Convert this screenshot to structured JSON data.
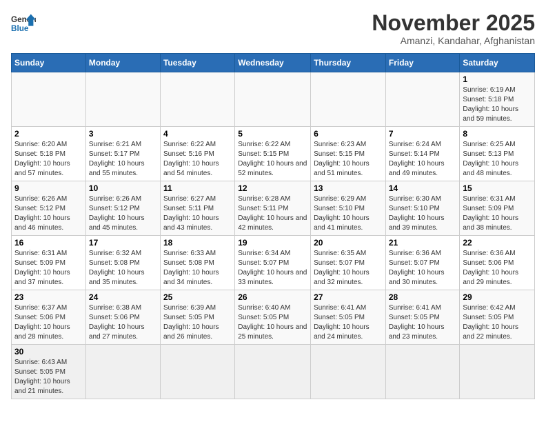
{
  "logo": {
    "text_general": "General",
    "text_blue": "Blue"
  },
  "header": {
    "title": "November 2025",
    "subtitle": "Amanzi, Kandahar, Afghanistan"
  },
  "weekdays": [
    "Sunday",
    "Monday",
    "Tuesday",
    "Wednesday",
    "Thursday",
    "Friday",
    "Saturday"
  ],
  "days": [
    {
      "num": "",
      "info": ""
    },
    {
      "num": "",
      "info": ""
    },
    {
      "num": "",
      "info": ""
    },
    {
      "num": "",
      "info": ""
    },
    {
      "num": "",
      "info": ""
    },
    {
      "num": "",
      "info": ""
    },
    {
      "num": "1",
      "info": "Sunrise: 6:19 AM\nSunset: 5:18 PM\nDaylight: 10 hours and 59 minutes."
    },
    {
      "num": "2",
      "info": "Sunrise: 6:20 AM\nSunset: 5:18 PM\nDaylight: 10 hours and 57 minutes."
    },
    {
      "num": "3",
      "info": "Sunrise: 6:21 AM\nSunset: 5:17 PM\nDaylight: 10 hours and 55 minutes."
    },
    {
      "num": "4",
      "info": "Sunrise: 6:22 AM\nSunset: 5:16 PM\nDaylight: 10 hours and 54 minutes."
    },
    {
      "num": "5",
      "info": "Sunrise: 6:22 AM\nSunset: 5:15 PM\nDaylight: 10 hours and 52 minutes."
    },
    {
      "num": "6",
      "info": "Sunrise: 6:23 AM\nSunset: 5:15 PM\nDaylight: 10 hours and 51 minutes."
    },
    {
      "num": "7",
      "info": "Sunrise: 6:24 AM\nSunset: 5:14 PM\nDaylight: 10 hours and 49 minutes."
    },
    {
      "num": "8",
      "info": "Sunrise: 6:25 AM\nSunset: 5:13 PM\nDaylight: 10 hours and 48 minutes."
    },
    {
      "num": "9",
      "info": "Sunrise: 6:26 AM\nSunset: 5:12 PM\nDaylight: 10 hours and 46 minutes."
    },
    {
      "num": "10",
      "info": "Sunrise: 6:26 AM\nSunset: 5:12 PM\nDaylight: 10 hours and 45 minutes."
    },
    {
      "num": "11",
      "info": "Sunrise: 6:27 AM\nSunset: 5:11 PM\nDaylight: 10 hours and 43 minutes."
    },
    {
      "num": "12",
      "info": "Sunrise: 6:28 AM\nSunset: 5:11 PM\nDaylight: 10 hours and 42 minutes."
    },
    {
      "num": "13",
      "info": "Sunrise: 6:29 AM\nSunset: 5:10 PM\nDaylight: 10 hours and 41 minutes."
    },
    {
      "num": "14",
      "info": "Sunrise: 6:30 AM\nSunset: 5:10 PM\nDaylight: 10 hours and 39 minutes."
    },
    {
      "num": "15",
      "info": "Sunrise: 6:31 AM\nSunset: 5:09 PM\nDaylight: 10 hours and 38 minutes."
    },
    {
      "num": "16",
      "info": "Sunrise: 6:31 AM\nSunset: 5:09 PM\nDaylight: 10 hours and 37 minutes."
    },
    {
      "num": "17",
      "info": "Sunrise: 6:32 AM\nSunset: 5:08 PM\nDaylight: 10 hours and 35 minutes."
    },
    {
      "num": "18",
      "info": "Sunrise: 6:33 AM\nSunset: 5:08 PM\nDaylight: 10 hours and 34 minutes."
    },
    {
      "num": "19",
      "info": "Sunrise: 6:34 AM\nSunset: 5:07 PM\nDaylight: 10 hours and 33 minutes."
    },
    {
      "num": "20",
      "info": "Sunrise: 6:35 AM\nSunset: 5:07 PM\nDaylight: 10 hours and 32 minutes."
    },
    {
      "num": "21",
      "info": "Sunrise: 6:36 AM\nSunset: 5:07 PM\nDaylight: 10 hours and 30 minutes."
    },
    {
      "num": "22",
      "info": "Sunrise: 6:36 AM\nSunset: 5:06 PM\nDaylight: 10 hours and 29 minutes."
    },
    {
      "num": "23",
      "info": "Sunrise: 6:37 AM\nSunset: 5:06 PM\nDaylight: 10 hours and 28 minutes."
    },
    {
      "num": "24",
      "info": "Sunrise: 6:38 AM\nSunset: 5:06 PM\nDaylight: 10 hours and 27 minutes."
    },
    {
      "num": "25",
      "info": "Sunrise: 6:39 AM\nSunset: 5:05 PM\nDaylight: 10 hours and 26 minutes."
    },
    {
      "num": "26",
      "info": "Sunrise: 6:40 AM\nSunset: 5:05 PM\nDaylight: 10 hours and 25 minutes."
    },
    {
      "num": "27",
      "info": "Sunrise: 6:41 AM\nSunset: 5:05 PM\nDaylight: 10 hours and 24 minutes."
    },
    {
      "num": "28",
      "info": "Sunrise: 6:41 AM\nSunset: 5:05 PM\nDaylight: 10 hours and 23 minutes."
    },
    {
      "num": "29",
      "info": "Sunrise: 6:42 AM\nSunset: 5:05 PM\nDaylight: 10 hours and 22 minutes."
    },
    {
      "num": "30",
      "info": "Sunrise: 6:43 AM\nSunset: 5:05 PM\nDaylight: 10 hours and 21 minutes."
    },
    {
      "num": "",
      "info": ""
    },
    {
      "num": "",
      "info": ""
    },
    {
      "num": "",
      "info": ""
    },
    {
      "num": "",
      "info": ""
    },
    {
      "num": "",
      "info": ""
    },
    {
      "num": "",
      "info": ""
    }
  ]
}
